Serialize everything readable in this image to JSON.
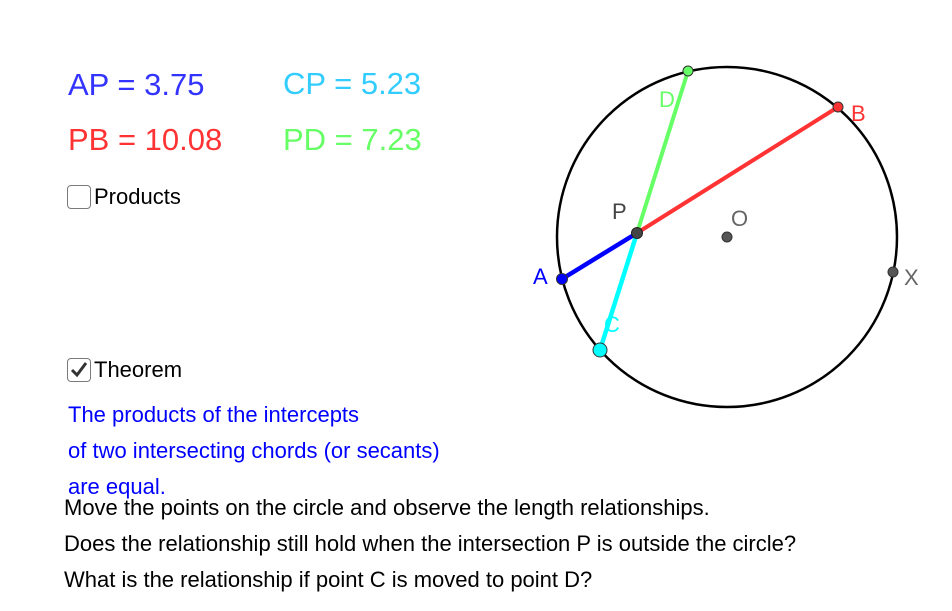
{
  "measurements": {
    "ap": {
      "text": "AP = 3.75",
      "color": "#3333ff"
    },
    "cp": {
      "text": "CP = 5.23",
      "color": "#33ccff"
    },
    "pb": {
      "text": "PB = 10.08",
      "color": "#ff3333"
    },
    "pd": {
      "text": "PD = 7.23",
      "color": "#66ff66"
    }
  },
  "checkboxes": {
    "products": {
      "label": "Products",
      "checked": false
    },
    "theorem": {
      "label": "Theorem",
      "checked": true
    }
  },
  "theorem_text": [
    "The products of the intercepts",
    "of two intersecting chords (or secants)",
    "are equal."
  ],
  "instructions": [
    "Move the points on the circle and observe the length relationships.",
    "Does the relationship still hold when the intersection P is outside the circle?",
    "What is the relationship if point C is moved to point D?"
  ],
  "points": {
    "A": {
      "label": "A",
      "color": "#0000ff"
    },
    "B": {
      "label": "B",
      "color": "#ff3333"
    },
    "C": {
      "label": "C",
      "color": "#00ffff"
    },
    "D": {
      "label": "D",
      "color": "#66ff66"
    },
    "P": {
      "label": "P",
      "color": "#444444"
    },
    "O": {
      "label": "O",
      "color": "#666666"
    },
    "X": {
      "label": "X",
      "color": "#666666"
    }
  }
}
